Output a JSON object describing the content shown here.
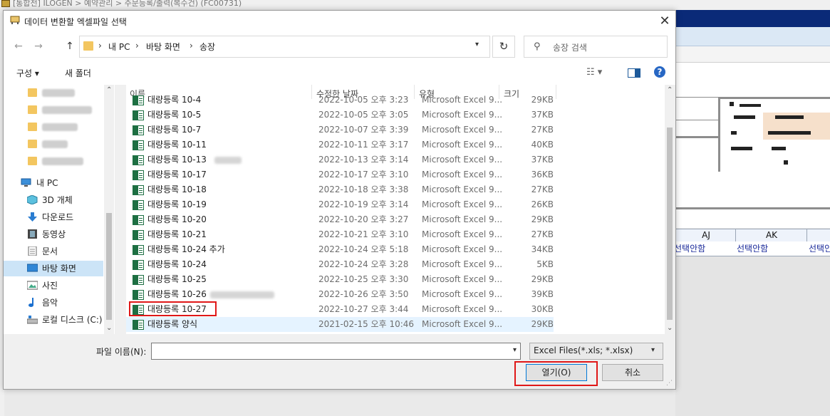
{
  "background_app": {
    "title": "[통합전] ILOGEN > 예약관리 > 주문등록/출력(복수건) (FC00731)",
    "grid_headers": [
      "AJ",
      "AK"
    ],
    "grid_cells": [
      "선택안함",
      "선택안함",
      "선택안"
    ]
  },
  "dialog": {
    "title": "데이터 변환할 엑셀파일 선택",
    "close_label": "✕"
  },
  "nav": {
    "back": "←",
    "forward": "→",
    "up": "↑",
    "breadcrumb": [
      "내 PC",
      "바탕 화면",
      "송장"
    ],
    "refresh": "↻",
    "search_placeholder": "송장 검색"
  },
  "commands": {
    "organize": "구성 ▾",
    "new_folder": "새 폴더",
    "help": "?"
  },
  "sidebar": {
    "this_pc": "내 PC",
    "items": [
      {
        "label": "3D 개체",
        "icon": "3d-objects-icon"
      },
      {
        "label": "다운로드",
        "icon": "download-icon"
      },
      {
        "label": "동영상",
        "icon": "video-icon"
      },
      {
        "label": "문서",
        "icon": "document-icon"
      },
      {
        "label": "바탕 화면",
        "icon": "desktop-icon",
        "selected": true
      },
      {
        "label": "사진",
        "icon": "pictures-icon"
      },
      {
        "label": "음악",
        "icon": "music-icon"
      },
      {
        "label": "로컬 디스크 (C:)",
        "icon": "drive-icon"
      }
    ]
  },
  "file_list": {
    "columns": [
      "이름",
      "수정한 날짜",
      "유형",
      "크기"
    ],
    "rows": [
      {
        "name": "대량등록 10-4",
        "date": "2022-10-05 오후 3:23",
        "type": "Microsoft Excel 9...",
        "size": "29KB"
      },
      {
        "name": "대량등록 10-5",
        "date": "2022-10-05 오후 3:05",
        "type": "Microsoft Excel 9...",
        "size": "37KB"
      },
      {
        "name": "대량등록 10-7",
        "date": "2022-10-07 오후 3:39",
        "type": "Microsoft Excel 9...",
        "size": "27KB"
      },
      {
        "name": "대량등록 10-11",
        "date": "2022-10-11 오후 3:17",
        "type": "Microsoft Excel 9...",
        "size": "40KB"
      },
      {
        "name": "대량등록 10-13",
        "date": "2022-10-13 오후 3:14",
        "type": "Microsoft Excel 9...",
        "size": "37KB",
        "blur": 1
      },
      {
        "name": "대량등록 10-17",
        "date": "2022-10-17 오후 3:10",
        "type": "Microsoft Excel 9...",
        "size": "36KB"
      },
      {
        "name": "대량등록 10-18",
        "date": "2022-10-18 오후 3:38",
        "type": "Microsoft Excel 9...",
        "size": "27KB"
      },
      {
        "name": "대량등록 10-19",
        "date": "2022-10-19 오후 3:14",
        "type": "Microsoft Excel 9...",
        "size": "26KB"
      },
      {
        "name": "대량등록 10-20",
        "date": "2022-10-20 오후 3:27",
        "type": "Microsoft Excel 9...",
        "size": "29KB"
      },
      {
        "name": "대량등록 10-21",
        "date": "2022-10-21 오후 3:10",
        "type": "Microsoft Excel 9...",
        "size": "27KB"
      },
      {
        "name": "대량등록 10-24 추가",
        "date": "2022-10-24 오후 5:18",
        "type": "Microsoft Excel 9...",
        "size": "34KB"
      },
      {
        "name": "대량등록 10-24",
        "date": "2022-10-24 오후 3:28",
        "type": "Microsoft Excel 9...",
        "size": "5KB"
      },
      {
        "name": "대량등록 10-25",
        "date": "2022-10-25 오후 3:30",
        "type": "Microsoft Excel 9...",
        "size": "29KB"
      },
      {
        "name": "대량등록 10-26",
        "date": "2022-10-26 오후 3:50",
        "type": "Microsoft Excel 9...",
        "size": "39KB",
        "blur": 2
      },
      {
        "name": "대량등록 10-27",
        "date": "2022-10-27 오후 3:44",
        "type": "Microsoft Excel 9...",
        "size": "30KB",
        "highlight": true
      },
      {
        "name": "대량등록 양식",
        "date": "2021-02-15 오후 10:46",
        "type": "Microsoft Excel 9...",
        "size": "29KB",
        "selected": true
      }
    ]
  },
  "footer": {
    "filename_label": "파일 이름(N):",
    "filename_value": "",
    "filetype": "Excel Files(*.xls; *.xlsx)",
    "open": "열기(O)",
    "cancel": "취소"
  }
}
